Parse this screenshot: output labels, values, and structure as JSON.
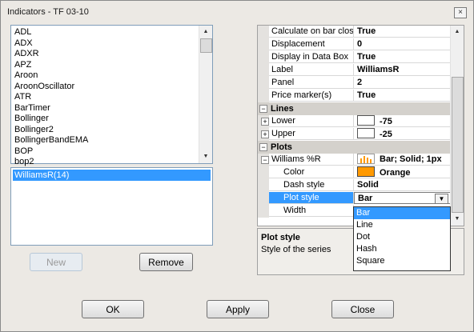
{
  "window": {
    "title": "Indicators - TF 03-10",
    "close_glyph": "×"
  },
  "indicator_list": {
    "items": [
      "ADL",
      "ADX",
      "ADXR",
      "APZ",
      "Aroon",
      "AroonOscillator",
      "ATR",
      "BarTimer",
      "Bollinger",
      "Bollinger2",
      "BollingerBandEMA",
      "BOP",
      "bop2"
    ]
  },
  "applied_list": {
    "items": [
      "WilliamsR(14)"
    ]
  },
  "buttons": {
    "new": "New",
    "remove": "Remove",
    "ok": "OK",
    "apply": "Apply",
    "close": "Close"
  },
  "properties": {
    "top_rows": [
      {
        "name": "Calculate on bar close",
        "value": "True"
      },
      {
        "name": "Displacement",
        "value": "0"
      },
      {
        "name": "Display in Data Box",
        "value": "True"
      },
      {
        "name": "Label",
        "value": "WilliamsR"
      },
      {
        "name": "Panel",
        "value": "2"
      },
      {
        "name": "Price marker(s)",
        "value": "True"
      }
    ],
    "lines_category": "Lines",
    "lines": [
      {
        "name": "Lower",
        "value": "-75"
      },
      {
        "name": "Upper",
        "value": "-25"
      }
    ],
    "plots_category": "Plots",
    "plot": {
      "name": "Williams %R",
      "value": "Bar; Solid; 1px"
    },
    "plot_props": {
      "color": {
        "name": "Color",
        "value": "Orange"
      },
      "dash": {
        "name": "Dash style",
        "value": "Solid"
      },
      "style": {
        "name": "Plot style",
        "value": "Bar"
      },
      "width": {
        "name": "Width",
        "value": ""
      }
    },
    "colors": {
      "orange": "#ff9900",
      "selection": "#3399ff"
    }
  },
  "plot_style_options": [
    "Bar",
    "Line",
    "Dot",
    "Hash",
    "Square"
  ],
  "help": {
    "title": "Plot style",
    "description": "Style of the series"
  }
}
